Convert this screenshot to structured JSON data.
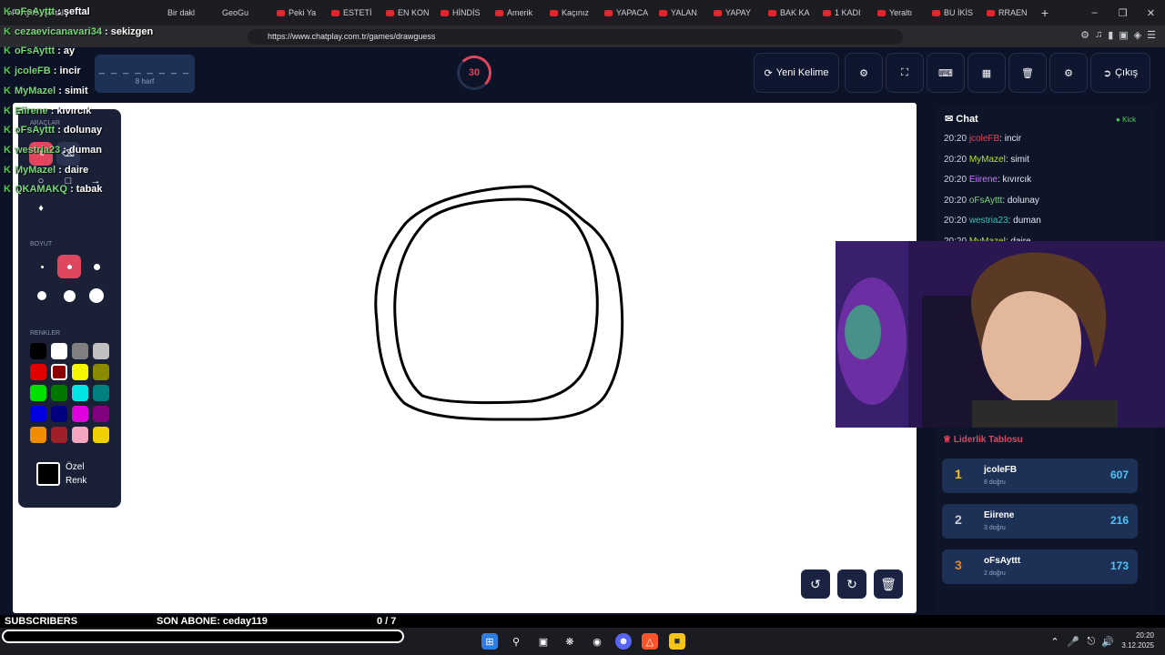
{
  "browser": {
    "tabs": [
      "oFsAyttt : şeftal",
      "",
      "Bir dakl",
      "GeoGu",
      "Peki Ya",
      "ESTETİ",
      "EN KON",
      "HİNDİS",
      "Amerik",
      "Kaçınız",
      "YAPACA",
      "YALAN",
      "YAPAY",
      "BAK KA",
      "1 KADI",
      "Yeraltı",
      "BU İKİS",
      "RRAEN"
    ],
    "url": "https://www.chatplay.com.tr/games/drawguess"
  },
  "game": {
    "word_hint": "_ _ _ _ _ _ _ _",
    "word_length": "8 harf",
    "timer": "30",
    "new_word": "Yeni Kelime",
    "exit": "Çıkış"
  },
  "tools": {
    "tools_title": "ARAÇLAR",
    "size_title": "BOYUT",
    "colors_title": "RENKLER",
    "custom_color": "Özel Renk",
    "swatches": [
      "#000000",
      "#ffffff",
      "#808080",
      "#c0c0c0",
      "#e00000",
      "#8b0000",
      "#f5f500",
      "#8a8a00",
      "#00e000",
      "#007800",
      "#00e5e5",
      "#008080",
      "#0000e0",
      "#000080",
      "#e000e0",
      "#800080",
      "#f08c00",
      "#a0202a",
      "#f4a6c0",
      "#f0d000"
    ]
  },
  "overlay_chat": [
    {
      "user": "oFsAyttt",
      "text": " : şeftal"
    },
    {
      "user": "cezaevicanavari34",
      "text": " : sekizgen"
    },
    {
      "user": "oFsAyttt",
      "text": " : ay"
    },
    {
      "user": "jcoleFB",
      "text": " : incir"
    },
    {
      "user": "MyMazel",
      "text": " : simit"
    },
    {
      "user": "Eiirene",
      "text": " : kıvırcık"
    },
    {
      "user": "oFsAyttt",
      "text": " : dolunay"
    },
    {
      "user": "westria23",
      "text": " : duman"
    },
    {
      "user": "MyMazel",
      "text": " : daire"
    },
    {
      "user": "QKAMAKQ",
      "text": " : tabak"
    }
  ],
  "chat": {
    "title": "Chat",
    "platform": "Kick",
    "messages": [
      {
        "time": "20:20",
        "user": "jcoleFB",
        "color": "#e0465e",
        "text": ": incir"
      },
      {
        "time": "20:20",
        "user": "MyMazel",
        "color": "#b5e61d",
        "text": ": simit"
      },
      {
        "time": "20:20",
        "user": "Eiirene",
        "color": "#c77dff",
        "text": ": kıvırcık"
      },
      {
        "time": "20:20",
        "user": "oFsAyttt",
        "color": "#7ad67a",
        "text": ": dolunay"
      },
      {
        "time": "20:20",
        "user": "westria23",
        "color": "#2ec4b6",
        "text": ": duman"
      },
      {
        "time": "20:20",
        "user": "MyMazel",
        "color": "#b5e61d",
        "text": ": daire"
      }
    ]
  },
  "leaderboard": {
    "title": "Liderlik Tablosu",
    "rows": [
      {
        "rank": "1",
        "name": "jcoleFB",
        "sub": "8 doğru",
        "score": "607",
        "color": "#f5c518"
      },
      {
        "rank": "2",
        "name": "Eiirene",
        "sub": "3 doğru",
        "score": "216",
        "color": "#c8ccd6"
      },
      {
        "rank": "3",
        "name": "oFsAyttt",
        "sub": "2 doğru",
        "score": "173",
        "color": "#d98c3a"
      }
    ]
  },
  "stream_bar": {
    "subscribers": "SUBSCRIBERS",
    "last_sub": "SON ABONE: ceday119",
    "goal": "0 / 7"
  },
  "taskbar": {
    "time": "20:20",
    "date": "3.12.2025"
  }
}
